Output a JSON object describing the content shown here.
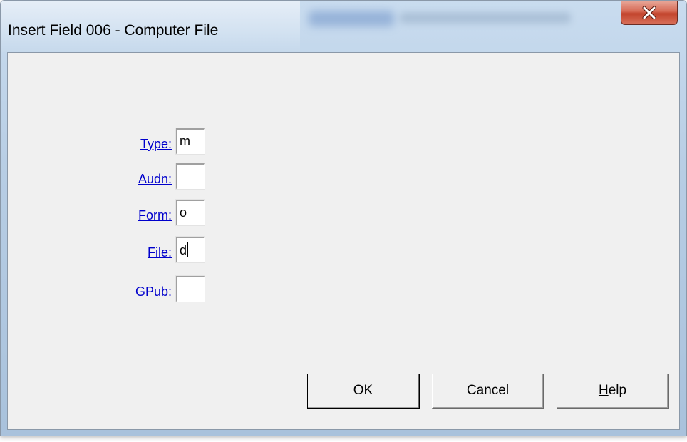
{
  "window": {
    "title": "Insert Field 006 - Computer File",
    "close_icon": "close-x-icon"
  },
  "fields": [
    {
      "label": "Type:",
      "value": "m"
    },
    {
      "label": "Audn:",
      "value": ""
    },
    {
      "label": "Form:",
      "value": "o"
    },
    {
      "label": "File:",
      "value": "d"
    },
    {
      "label": "GPub:",
      "value": ""
    }
  ],
  "buttons": {
    "ok": "OK",
    "cancel": "Cancel",
    "help_mnemonic": "H",
    "help_rest": "elp"
  },
  "colors": {
    "link": "#0000cc",
    "dialog_bg": "#f0f0f0",
    "close_button": "#c2442d"
  }
}
